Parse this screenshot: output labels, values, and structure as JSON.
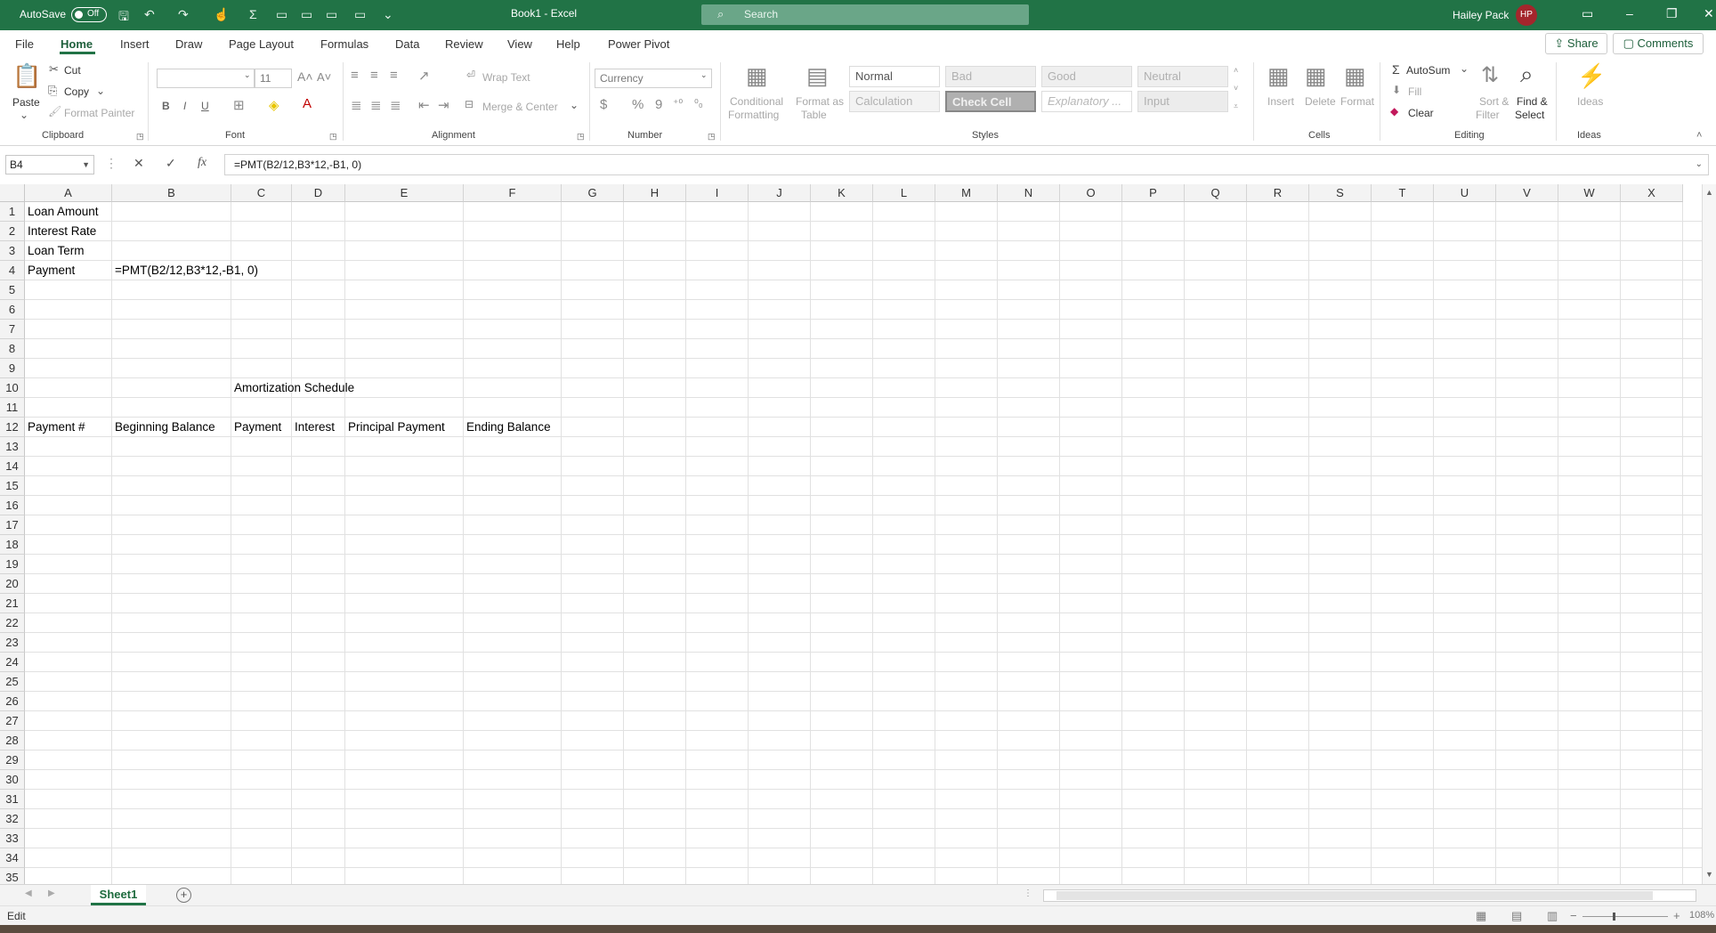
{
  "titlebar": {
    "autosave_label": "AutoSave",
    "autosave_state": "Off",
    "doc_title": "Book1  -  Excel",
    "search_placeholder": "Search",
    "user_name": "Hailey Pack",
    "user_initials": "HP",
    "accent_color": "#217346"
  },
  "menu": {
    "tabs": [
      "File",
      "Home",
      "Insert",
      "Draw",
      "Page Layout",
      "Formulas",
      "Data",
      "Review",
      "View",
      "Help",
      "Power Pivot"
    ],
    "active_tab": "Home",
    "share_label": "Share",
    "comments_label": "Comments"
  },
  "ribbon": {
    "clipboard": {
      "paste": "Paste",
      "cut": "Cut",
      "copy": "Copy",
      "format_painter": "Format Painter",
      "label": "Clipboard"
    },
    "font": {
      "size": "11",
      "bold": "B",
      "italic": "I",
      "underline": "U",
      "label": "Font"
    },
    "alignment": {
      "wrap_text": "Wrap Text",
      "merge_center": "Merge & Center",
      "label": "Alignment"
    },
    "number": {
      "format": "Currency",
      "dollar": "$",
      "percent": "%",
      "comma": "9",
      "label": "Number"
    },
    "styles": {
      "conditional_formatting": [
        "Conditional",
        "Formatting"
      ],
      "format_as_table": [
        "Format as",
        "Table"
      ],
      "cells": [
        "Normal",
        "Bad",
        "Good",
        "Neutral",
        "Calculation",
        "Check Cell",
        "Explanatory ...",
        "Input"
      ],
      "label": "Styles"
    },
    "cells": {
      "insert": "Insert",
      "delete": "Delete",
      "format": "Format",
      "label": "Cells"
    },
    "editing": {
      "autosum": "AutoSum",
      "fill": "Fill",
      "clear": "Clear",
      "sort_filter": [
        "Sort &",
        "Filter"
      ],
      "find_select": [
        "Find &",
        "Select"
      ],
      "label": "Editing"
    },
    "ideas": {
      "ideas": "Ideas",
      "label": "Ideas"
    }
  },
  "formula_bar": {
    "name_box": "B4",
    "formula": "=PMT(B2/12,B3*12,-B1, 0)",
    "fx": "fx"
  },
  "grid": {
    "columns": [
      "A",
      "B",
      "C",
      "D",
      "E",
      "F",
      "G",
      "H",
      "I",
      "J",
      "K",
      "L",
      "M",
      "N",
      "O",
      "P",
      "Q",
      "R",
      "S",
      "T",
      "U",
      "V",
      "W",
      "X"
    ],
    "rows": [
      "1",
      "2",
      "3",
      "4",
      "5",
      "6",
      "7",
      "8",
      "9",
      "10",
      "11",
      "12",
      "13",
      "14",
      "15",
      "16",
      "17",
      "18",
      "19",
      "20",
      "21",
      "22",
      "23",
      "24",
      "25",
      "26",
      "27",
      "28",
      "29",
      "30",
      "31",
      "32",
      "33",
      "34",
      "35"
    ],
    "cells": {
      "A1": "Loan Amount",
      "A2": "Interest Rate",
      "A3": "Loan Term",
      "A4": "Payment",
      "B4": "=PMT(B2/12,B3*12,-B1, 0)",
      "C10": "Amortization Schedule",
      "A12": "Payment #",
      "B12": "Beginning Balance",
      "C12": "Payment",
      "D12": "Interest",
      "E12": "Principal Payment",
      "F12": "Ending Balance"
    }
  },
  "sheets": {
    "tabs": [
      "Sheet1"
    ],
    "active": "Sheet1"
  },
  "status": {
    "mode": "Edit",
    "zoom": "108%"
  }
}
